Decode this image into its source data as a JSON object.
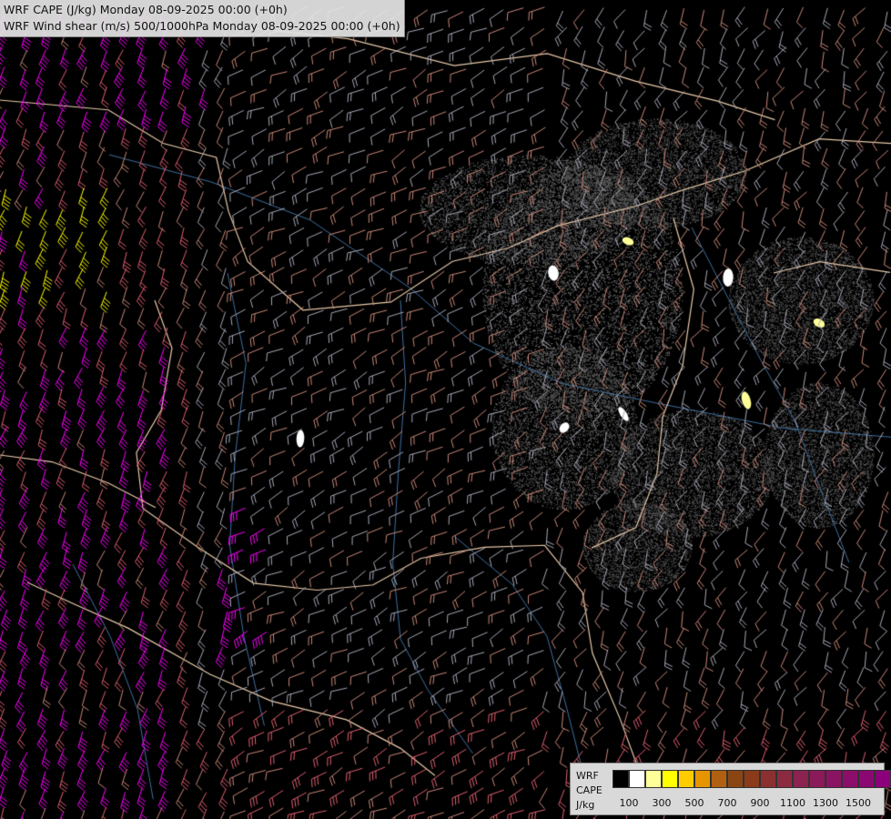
{
  "header": {
    "line1": "WRF CAPE (J/kg) Monday 08-09-2025 00:00 (+0h)",
    "line2": "WRF Wind shear (m/s) 500/1000hPa Monday 08-09-2025 00:00 (+0h)"
  },
  "legend": {
    "title_1": "WRF",
    "title_2": "CAPE",
    "unit": "J/kg",
    "colors": [
      "#000000",
      "#ffffff",
      "#ffff99",
      "#ffff00",
      "#ffcc00",
      "#e69500",
      "#b06010",
      "#8b4513",
      "#8b3a1a",
      "#8b3030",
      "#8b2a40",
      "#8b2250",
      "#8b1a5a",
      "#8b1462",
      "#8b0e6a",
      "#8b0872",
      "#8b007a",
      "#9a0088"
    ],
    "tick_labels": [
      "100",
      "300",
      "500",
      "700",
      "900",
      "1100",
      "1300",
      "1500"
    ]
  },
  "map": {
    "colors": {
      "background": "#000000",
      "border": "#e8c9a8",
      "river": "#3f6fa0",
      "barb_low": "#a8a8b8",
      "barb_mid": "#c98878",
      "barb_high": "#e06070",
      "barb_very_high": "#ff00ff",
      "barb_extreme": "#ffff00",
      "stipple": "#606060"
    }
  }
}
